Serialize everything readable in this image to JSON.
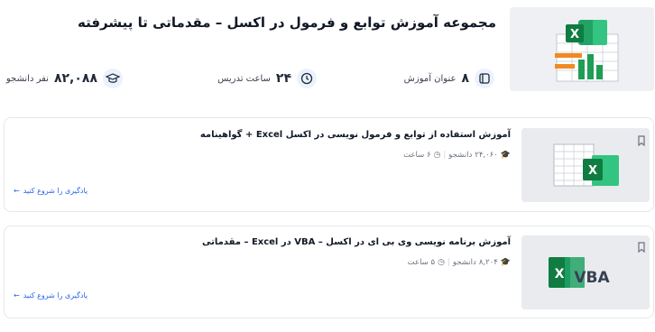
{
  "header": {
    "title": "مجموعه آموزش توابع و فرمول در اکسل – مقدماتی تا پیشرفته",
    "stats": {
      "courses_value": "۸",
      "courses_label": "عنوان آموزش",
      "hours_value": "۲۴",
      "hours_label": "ساعت تدریس",
      "students_value": "۸۲,۰۸۸",
      "students_label": "نفر دانشجو"
    }
  },
  "courses": [
    {
      "title": "آموزش استفاده از توابع و فرمول نویسی در اکسل Excel + گواهینامه",
      "students": "۲۴,۰۶۰",
      "students_unit": "دانشجو",
      "duration": "۶ ساعت",
      "cta": "یادگیری را شروع کنید"
    },
    {
      "title": "آموزش برنامه نویسی وی بی ای در اکسل – VBA در Excel – مقدماتی",
      "students": "۸,۲۰۴",
      "students_unit": "دانشجو",
      "duration": "۵ ساعت",
      "cta": "یادگیری را شروع کنید",
      "thumb_text": "VBA"
    }
  ],
  "colors": {
    "excel_green": "#1e7145",
    "accent_blue": "#2563eb",
    "orange": "#f08a24"
  }
}
